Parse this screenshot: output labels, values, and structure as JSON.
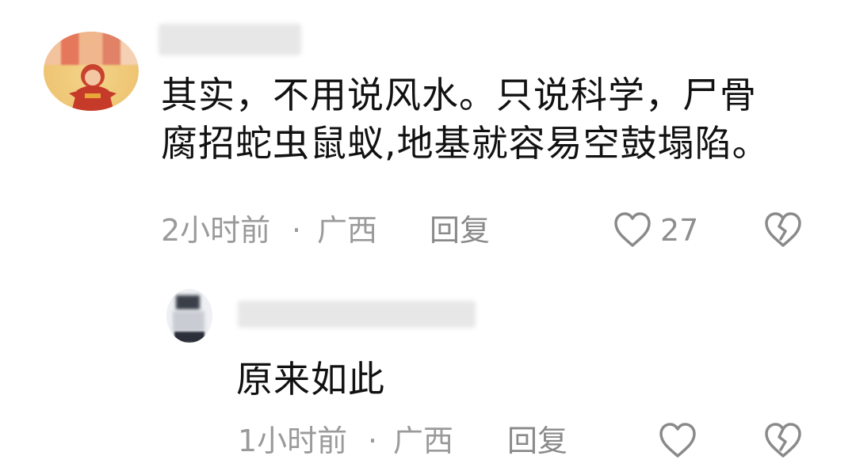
{
  "comment": {
    "text_line1": "其实，不用说风水。只说科学，尸骨",
    "text_line2": "腐招蛇虫鼠蚁,地基就容易空鼓塌陷。",
    "time": "2小时前",
    "separator": "·",
    "location": "广西",
    "reply_label": "回复",
    "like_count": "27",
    "icons": {
      "like": "heart-outline-icon",
      "dislike": "broken-heart-icon"
    }
  },
  "reply": {
    "text": "原来如此",
    "time": "1小时前",
    "separator": "·",
    "location": "广西",
    "reply_label": "回复",
    "icons": {
      "like": "heart-outline-icon",
      "dislike": "broken-heart-icon"
    }
  },
  "colors": {
    "text": "#111111",
    "meta": "#9a9a9a",
    "icon": "#8a8a8a"
  }
}
